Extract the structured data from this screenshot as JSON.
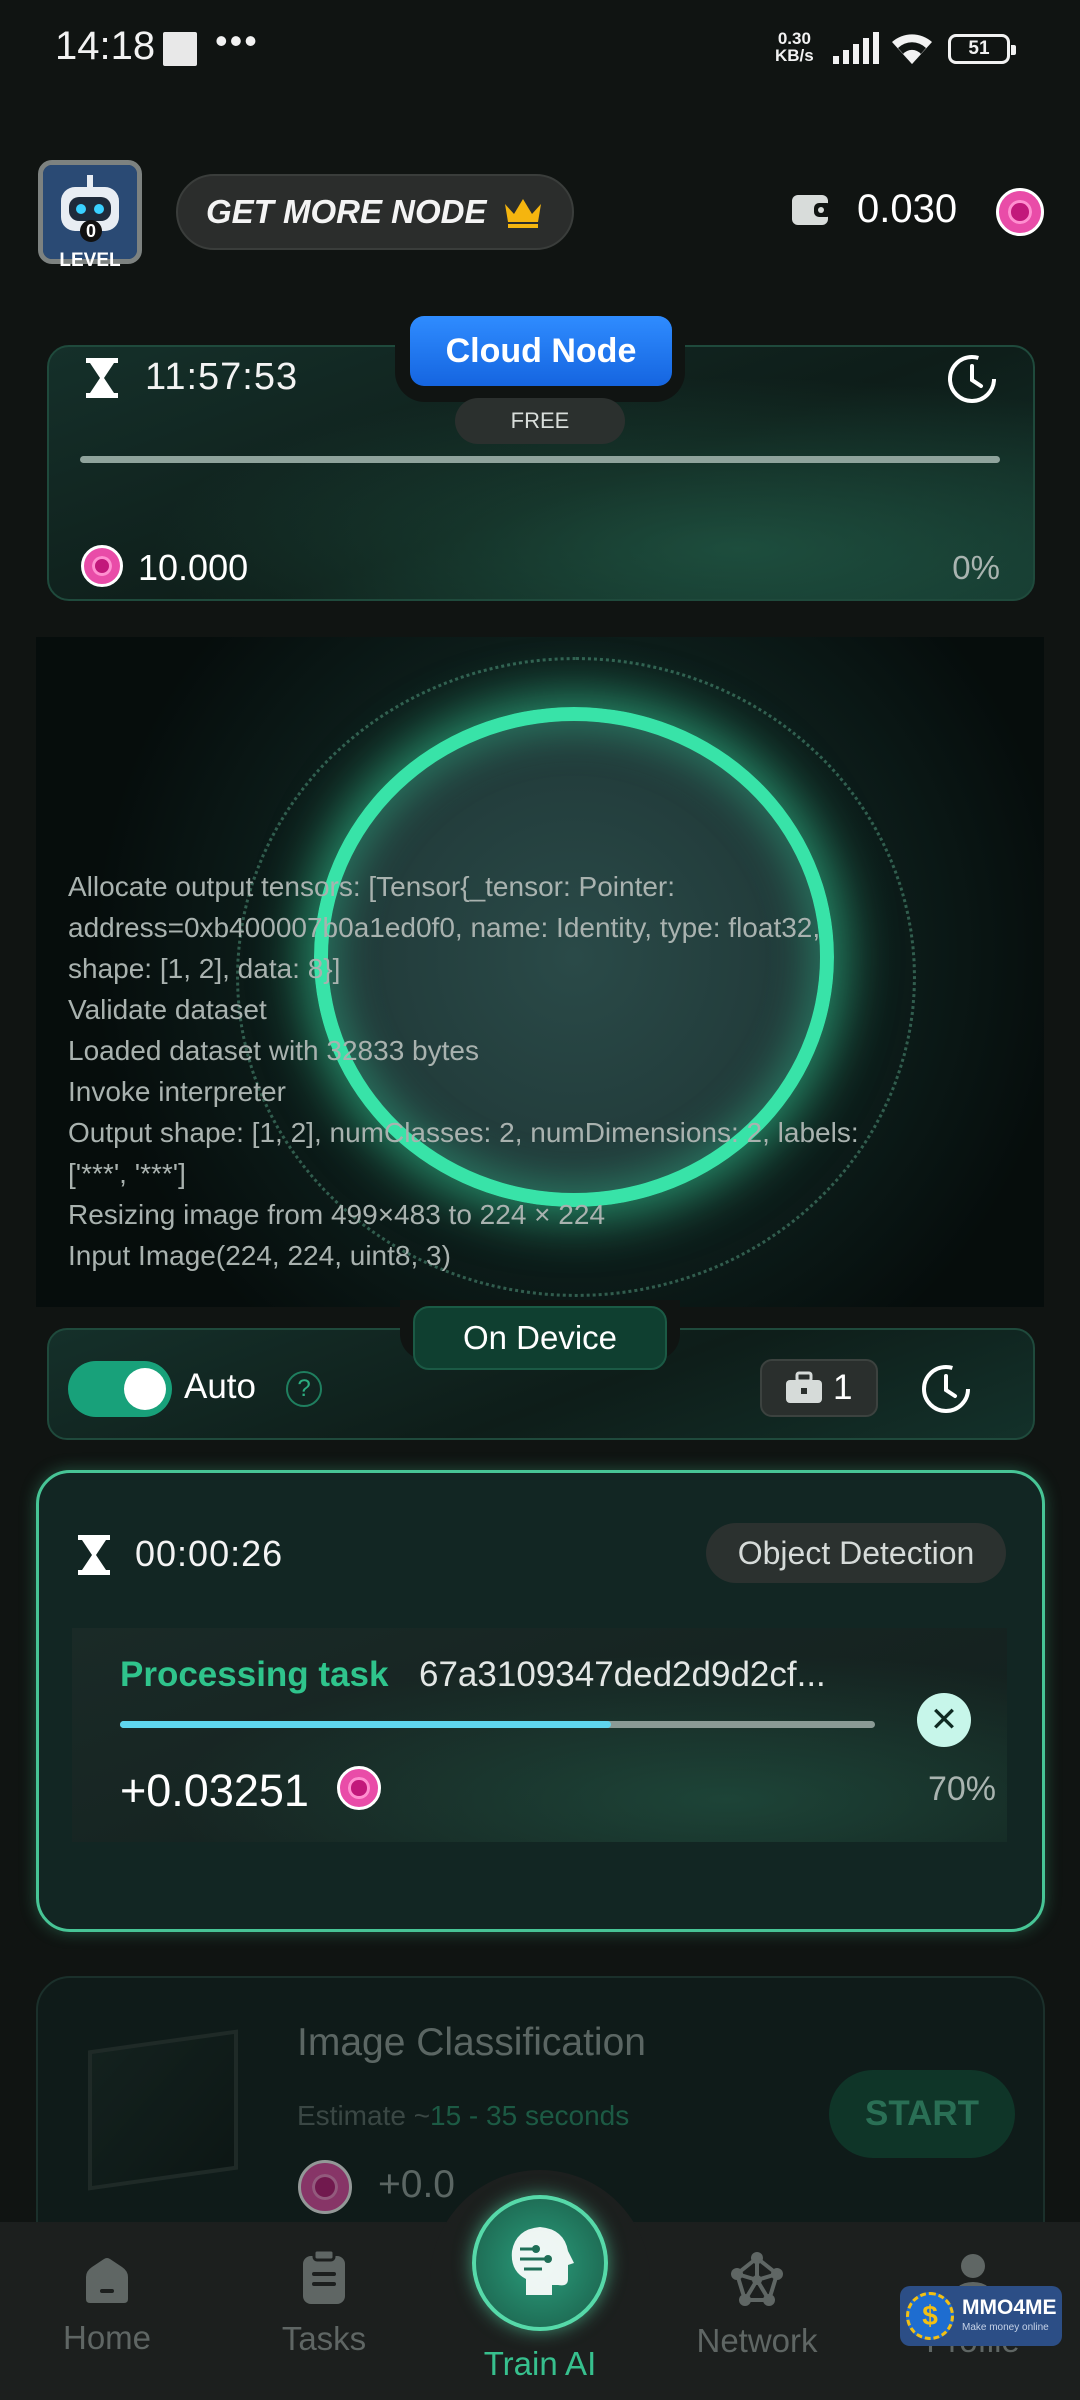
{
  "status_bar": {
    "time": "14:18",
    "dots": "•••",
    "net_speed_value": "0.30",
    "net_speed_unit": "KB/s",
    "battery": "51"
  },
  "header": {
    "avatar_level_number": "0",
    "avatar_level_label": "LEVEL",
    "get_more_label": "GET MORE NODE",
    "balance": "0.030"
  },
  "cloud_node": {
    "tab_label": "Cloud Node",
    "badge": "FREE",
    "timer": "11:57:53",
    "amount": "10.000",
    "progress_percent_label": "0%",
    "progress_fraction": 0.0
  },
  "log": {
    "lines": [
      "Allocate output tensors: [Tensor{_tensor: Pointer:",
      "address=0xb400007b0a1ed0f0, name: Identity, type: float32,",
      "shape: [1, 2], data: 8}]",
      "Validate dataset",
      "Loaded dataset with 32833 bytes",
      "Invoke interpreter",
      "Output shape: [1, 2], numClasses: 2, numDimensions: 2, labels:",
      "['***', '***']",
      "Resizing image from 499×483 to 224 × 224",
      "Input Image(224, 224, uint8, 3)"
    ]
  },
  "on_device": {
    "tab_label": "On Device",
    "auto_label": "Auto",
    "auto_enabled": true,
    "help_symbol": "?",
    "bag_count": "1"
  },
  "active_task": {
    "timer": "00:00:26",
    "type": "Object Detection",
    "processing_label": "Processing task",
    "task_id": "67a3109347ded2d9d2cf...",
    "reward": "+0.03251",
    "progress_percent_label": "70%",
    "progress_fraction": 0.65
  },
  "queued_task": {
    "title": "Image Classification",
    "estimate_label": "Estimate ~",
    "estimate_value": "15 - 35 seconds",
    "start_label": "START",
    "reward": "+0.0"
  },
  "bottom_nav": {
    "items": [
      {
        "label": "Home",
        "icon": "home-icon"
      },
      {
        "label": "Tasks",
        "icon": "clipboard-icon"
      },
      {
        "label": "Train AI",
        "icon": "ai-head-icon",
        "active": true
      },
      {
        "label": "Network",
        "icon": "network-icon"
      },
      {
        "label": "Profile",
        "icon": "profile-icon"
      }
    ]
  },
  "watermark": {
    "title": "MMO4ME",
    "subtitle": "Make money online",
    "coin_symbol": "$"
  },
  "colors": {
    "accent_green": "#2fc48c",
    "cloud_blue": "#2f8cff",
    "token_pink": "#e94ca8",
    "progress_cyan": "#5fd6ee"
  }
}
